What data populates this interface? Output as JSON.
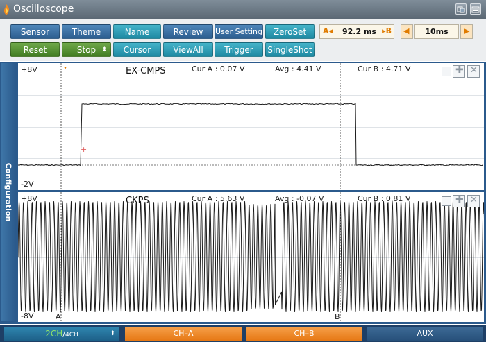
{
  "window": {
    "title": "Oscilloscope"
  },
  "toolbar": {
    "row1": {
      "sensor": "Sensor",
      "theme": "Theme",
      "name": "Name",
      "review": "Review",
      "user_setting": "User Setting",
      "zeroset": "ZeroSet"
    },
    "row2": {
      "reset": "Reset",
      "stop": "Stop",
      "cursor": "Cursor",
      "viewall": "ViewAll",
      "trigger": "Trigger",
      "singleshot": "SingleShot"
    },
    "cursor_ab": {
      "a_label": "A",
      "delta": "92.2 ms",
      "b_label": "B"
    },
    "timebase": {
      "value": "10ms"
    }
  },
  "sidebar": {
    "label": "Configuration"
  },
  "channel1": {
    "name": "EX-CMPS",
    "ymax": "+8V",
    "ymin": "-2V",
    "cur_a": "Cur A : 0.07 V",
    "avg": "Avg : 4.41 V",
    "cur_b": "Cur B : 4.71 V"
  },
  "channel2": {
    "name": "CKPS",
    "ymax": "+8V",
    "ymin": "-8V",
    "cur_a": "Cur A : 5.63 V",
    "avg": "Avg : -0.07 V",
    "cur_b": "Cur B : 0.81 V",
    "marker_a": "A",
    "marker_b": "B"
  },
  "bottom": {
    "ch_count_active": "2CH",
    "ch_sep": "/",
    "ch_count_alt": "4CH",
    "ch_a": "CH–A",
    "ch_b": "CH–B",
    "aux": "AUX"
  },
  "colors": {
    "accent_blue": "#2d5f90",
    "teal": "#1f8aa3",
    "green": "#427d22",
    "orange": "#f08a1c",
    "trace": "#1a1a1a"
  }
}
